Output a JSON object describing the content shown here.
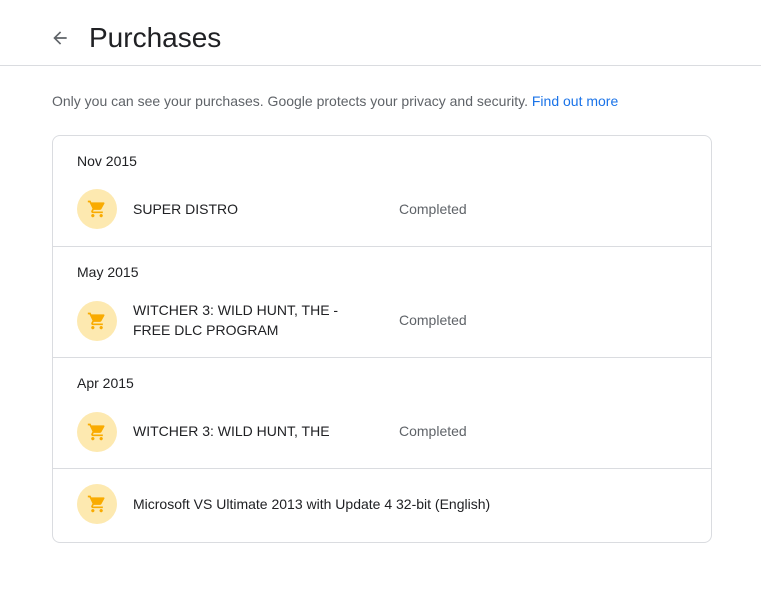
{
  "header": {
    "title": "Purchases"
  },
  "notice": {
    "text": "Only you can see your purchases. Google protects your privacy and security.",
    "link": "Find out more"
  },
  "colors": {
    "link": "#1a73e8",
    "cart_bg": "#fde9b0",
    "cart_icon": "#f9ab00"
  },
  "groups": [
    {
      "month": "Nov 2015",
      "items": [
        {
          "name": "SUPER DISTRO",
          "status": "Completed",
          "icon": "shopping-cart-icon"
        }
      ]
    },
    {
      "month": "May 2015",
      "items": [
        {
          "name": "WITCHER 3: WILD HUNT, THE - FREE DLC PROGRAM",
          "status": "Completed",
          "icon": "shopping-cart-icon"
        }
      ]
    },
    {
      "month": "Apr 2015",
      "items": [
        {
          "name": "WITCHER 3: WILD HUNT, THE",
          "status": "Completed",
          "icon": "shopping-cart-icon"
        }
      ]
    },
    {
      "month": "",
      "items": [
        {
          "name": "Microsoft VS Ultimate 2013 with Update 4 32-bit (English)",
          "status": "",
          "icon": "shopping-cart-icon"
        }
      ]
    }
  ]
}
